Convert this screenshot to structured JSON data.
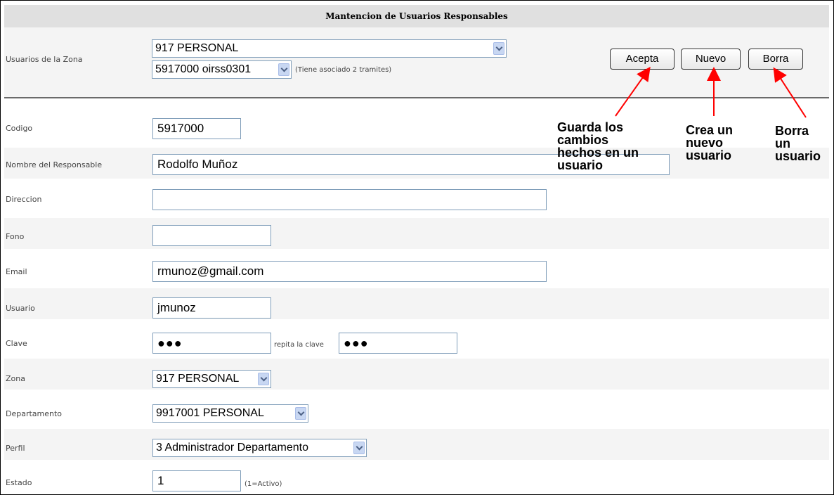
{
  "title": "Mantencion de Usuarios Responsables",
  "zone_users": {
    "label": "Usuarios de la Zona",
    "zone_select": "917 PERSONAL",
    "user_select": "5917000 oirss0301",
    "note": "(Tiene asociado 2 tramites)"
  },
  "buttons": {
    "accept": "Acepta",
    "new": "Nuevo",
    "delete": "Borra"
  },
  "form": {
    "codigo": {
      "label": "Codigo",
      "value": "5917000"
    },
    "nombre": {
      "label": "Nombre del Responsable",
      "value": "Rodolfo Muñoz"
    },
    "direccion": {
      "label": "Direccion",
      "value": ""
    },
    "fono": {
      "label": "Fono",
      "value": ""
    },
    "email": {
      "label": "Email",
      "value": "rmunoz@gmail.com"
    },
    "usuario": {
      "label": "Usuario",
      "value": "jmunoz"
    },
    "clave": {
      "label": "Clave",
      "value": "●●●",
      "repeat_label": "repita la clave",
      "repeat_value": "●●●"
    },
    "zona": {
      "label": "Zona",
      "value": "917 PERSONAL"
    },
    "departamento": {
      "label": "Departamento",
      "value": "9917001 PERSONAL"
    },
    "perfil": {
      "label": "Perfil",
      "value": "3 Administrador Departamento"
    },
    "estado": {
      "label": "Estado",
      "value": "1",
      "note": "(1=Activo)"
    }
  },
  "annotations": {
    "accept": [
      "Guarda los",
      "cambios",
      "hechos en un",
      "usuario"
    ],
    "new": [
      "Crea un",
      "nuevo",
      "usuario"
    ],
    "delete": [
      "Borra",
      "un",
      "usuario"
    ]
  },
  "colors": {
    "arrow": "#ff0000",
    "header_bg": "#e0e0e0",
    "row_bg": "#f4f4f4",
    "input_border": "#7f9db9"
  }
}
